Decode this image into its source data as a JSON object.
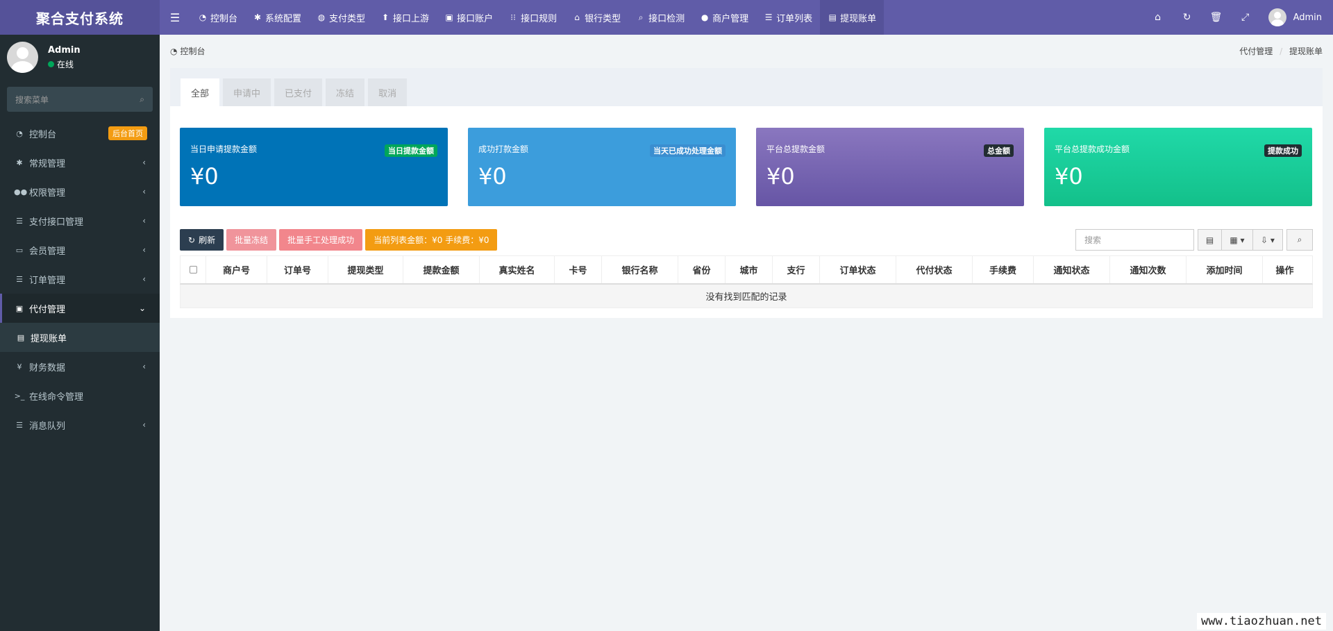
{
  "app": {
    "title": "聚合支付系统"
  },
  "topnav": [
    {
      "icon": "dashboard-icon",
      "glyph": "◔",
      "label": "控制台"
    },
    {
      "icon": "gear-icon",
      "glyph": "✱",
      "label": "系统配置"
    },
    {
      "icon": "globe-icon",
      "glyph": "◍",
      "label": "支付类型"
    },
    {
      "icon": "arrow-up-icon",
      "glyph": "⬆",
      "label": "接口上游"
    },
    {
      "icon": "account-icon",
      "glyph": "▣",
      "label": "接口账户"
    },
    {
      "icon": "rules-icon",
      "glyph": "⁝⁝",
      "label": "接口规则"
    },
    {
      "icon": "bank-icon",
      "glyph": "⌂",
      "label": "银行类型"
    },
    {
      "icon": "search-icon",
      "glyph": "⌕",
      "label": "接口检测"
    },
    {
      "icon": "user-icon",
      "glyph": "●",
      "label": "商户管理"
    },
    {
      "icon": "list-icon",
      "glyph": "☰",
      "label": "订单列表"
    },
    {
      "icon": "card-icon",
      "glyph": "▤",
      "label": "提现账单"
    }
  ],
  "header": {
    "username": "Admin"
  },
  "sidebar": {
    "user": {
      "name": "Admin",
      "status": "在线"
    },
    "search_placeholder": "搜索菜单",
    "items": [
      {
        "icon": "dashboard-icon",
        "glyph": "◔",
        "label": "控制台",
        "badge": "后台首页"
      },
      {
        "icon": "cogs-icon",
        "glyph": "✱",
        "label": "常规管理"
      },
      {
        "icon": "users-icon",
        "glyph": "●●",
        "label": "权限管理"
      },
      {
        "icon": "list-icon",
        "glyph": "☰",
        "label": "支付接口管理"
      },
      {
        "icon": "member-icon",
        "glyph": "▭",
        "label": "会员管理"
      },
      {
        "icon": "list-icon",
        "glyph": "☰",
        "label": "订单管理"
      },
      {
        "icon": "money-icon",
        "glyph": "▣",
        "label": "代付管理"
      },
      {
        "icon": "card-icon",
        "glyph": "▤",
        "label": "提现账单"
      },
      {
        "icon": "yen-icon",
        "glyph": "¥",
        "label": "财务数据"
      },
      {
        "icon": "terminal-icon",
        "glyph": ">_",
        "label": "在线命令管理"
      },
      {
        "icon": "list-icon",
        "glyph": "☰",
        "label": "消息队列"
      }
    ]
  },
  "breadcrumb": {
    "left": "控制台",
    "parent": "代付管理",
    "current": "提现账单"
  },
  "tabs": [
    "全部",
    "申请中",
    "已支付",
    "冻结",
    "取消"
  ],
  "cards": [
    {
      "title": "当日申请提款金额",
      "badge": "当日提款金额",
      "value": "¥0",
      "bg": "#0073b7",
      "badge_bg": "#00a65a",
      "badge_color": "#fff"
    },
    {
      "title": "成功打款金额",
      "badge": "当天已成功处理金额",
      "value": "¥0",
      "bg": "#3c9ddc",
      "badge_bg": "#3a8ed0",
      "badge_color": "#fff"
    },
    {
      "title": "平台总提款金额",
      "badge": "总金额",
      "value": "¥0",
      "bg": "#7d6ab0",
      "badge_bg": "#222d32",
      "badge_color": "#fff"
    },
    {
      "title": "平台总提款成功金额",
      "badge": "提款成功",
      "value": "¥0",
      "bg": "#1ccc98",
      "badge_bg": "#222d32",
      "badge_color": "#fff"
    }
  ],
  "toolbar": {
    "refresh": "刷新",
    "batch_freeze": "批量冻结",
    "batch_manual": "批量手工处理成功",
    "summary": "当前列表金额：¥0  手续费：¥0",
    "search_placeholder": "搜索"
  },
  "table": {
    "columns": [
      "商户号",
      "订单号",
      "提现类型",
      "提款金额",
      "真实姓名",
      "卡号",
      "银行名称",
      "省份",
      "城市",
      "支行",
      "订单状态",
      "代付状态",
      "手续费",
      "通知状态",
      "通知次数",
      "添加时间",
      "操作"
    ],
    "empty_text": "没有找到匹配的记录"
  },
  "watermark": "www.tiaozhuan.net"
}
